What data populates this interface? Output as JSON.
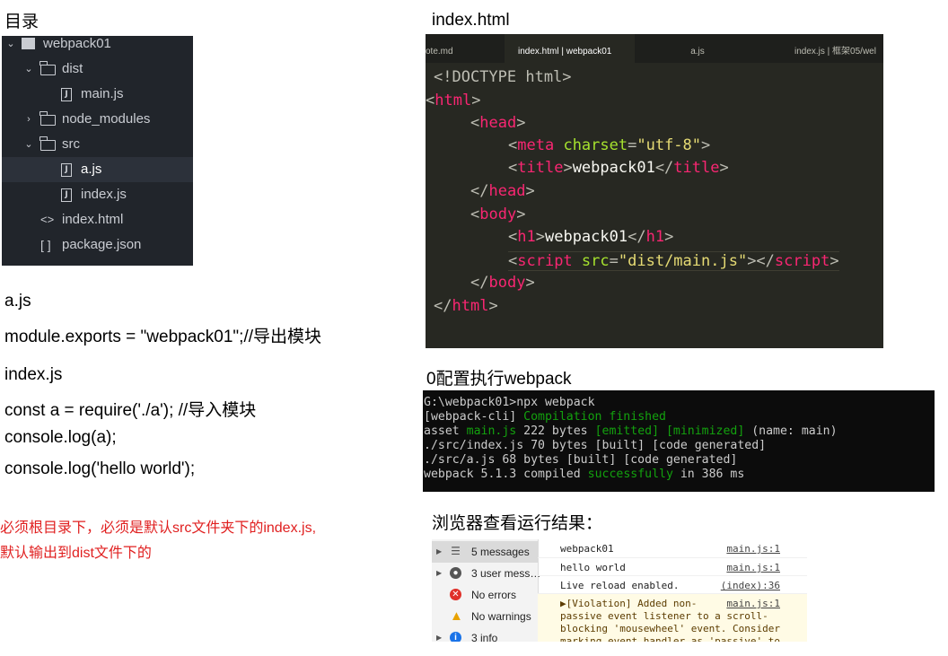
{
  "headings": {
    "directory": "目录",
    "index_html": "index.html",
    "zero_config": "0配置执行webpack",
    "browser_result": "浏览器查看运行结果："
  },
  "file_tree": {
    "root": "webpack01",
    "items": [
      {
        "label": "dist",
        "type": "folder",
        "expanded": true
      },
      {
        "label": "main.js",
        "type": "file"
      },
      {
        "label": "node_modules",
        "type": "folder",
        "expanded": false
      },
      {
        "label": "src",
        "type": "folder",
        "expanded": true
      },
      {
        "label": "a.js",
        "type": "file",
        "selected": true
      },
      {
        "label": "index.js",
        "type": "file"
      },
      {
        "label": "index.html",
        "type": "html"
      },
      {
        "label": "package.json",
        "type": "json"
      }
    ]
  },
  "a_js": {
    "title": "a.js",
    "code": "module.exports = \"webpack01\";//导出模块"
  },
  "index_js": {
    "title": "index.js",
    "lines": [
      "const a = require('./a'); //导入模块",
      "console.log(a);",
      "console.log('hello world');"
    ]
  },
  "note": {
    "line1": "必须根目录下，必须是默认src文件夹下的index.js,",
    "line2": "默认输出到dist文件下的",
    "color": "#e02020"
  },
  "editor": {
    "tabs": [
      "ote.md",
      "index.html | webpack01",
      "a.js",
      "index.js | 框架05/wel"
    ],
    "active_tab": 1,
    "code": {
      "doctype": "<!DOCTYPE html>",
      "title_text": "webpack01",
      "h1_text": "webpack01",
      "charset_value": "\"utf-8\"",
      "script_src_value": "\"dist/main.js\""
    }
  },
  "terminal": {
    "prompt": "G:\\webpack01>npx webpack",
    "cli_prefix": "[webpack-cli] ",
    "cli_msg": "Compilation finished",
    "asset_prefix": "asset ",
    "asset_name": "main.js",
    "asset_size": " 222 bytes ",
    "asset_tags": "[emitted] [minimized]",
    "asset_suffix": " (name: main)",
    "line_index": "./src/index.js 70 bytes [built] [code generated]",
    "line_a": "./src/a.js 68 bytes [built] [code generated]",
    "compiled_prefix": "webpack 5.1.3 compiled ",
    "compiled_word": "successfully",
    "compiled_suffix": " in 386 ms"
  },
  "devtools": {
    "sidebar": [
      {
        "label": "5 messages",
        "icon": "list-icon"
      },
      {
        "label": "3 user mess…",
        "icon": "user-icon"
      },
      {
        "label": "No errors",
        "icon": "error-icon"
      },
      {
        "label": "No warnings",
        "icon": "warning-icon"
      },
      {
        "label": "3 info",
        "icon": "info-icon"
      }
    ],
    "messages": [
      {
        "text": "webpack01",
        "source": "main.js:1"
      },
      {
        "text": "hello world",
        "source": "main.js:1"
      },
      {
        "text": "Live reload enabled.",
        "source": "(index):36"
      },
      {
        "text": "▶[Violation] Added non-\npassive event listener to a scroll-\nblocking 'mousewheel' event. Consider\nmarking event handler as 'passive' to",
        "source": "main.js:1"
      }
    ]
  }
}
